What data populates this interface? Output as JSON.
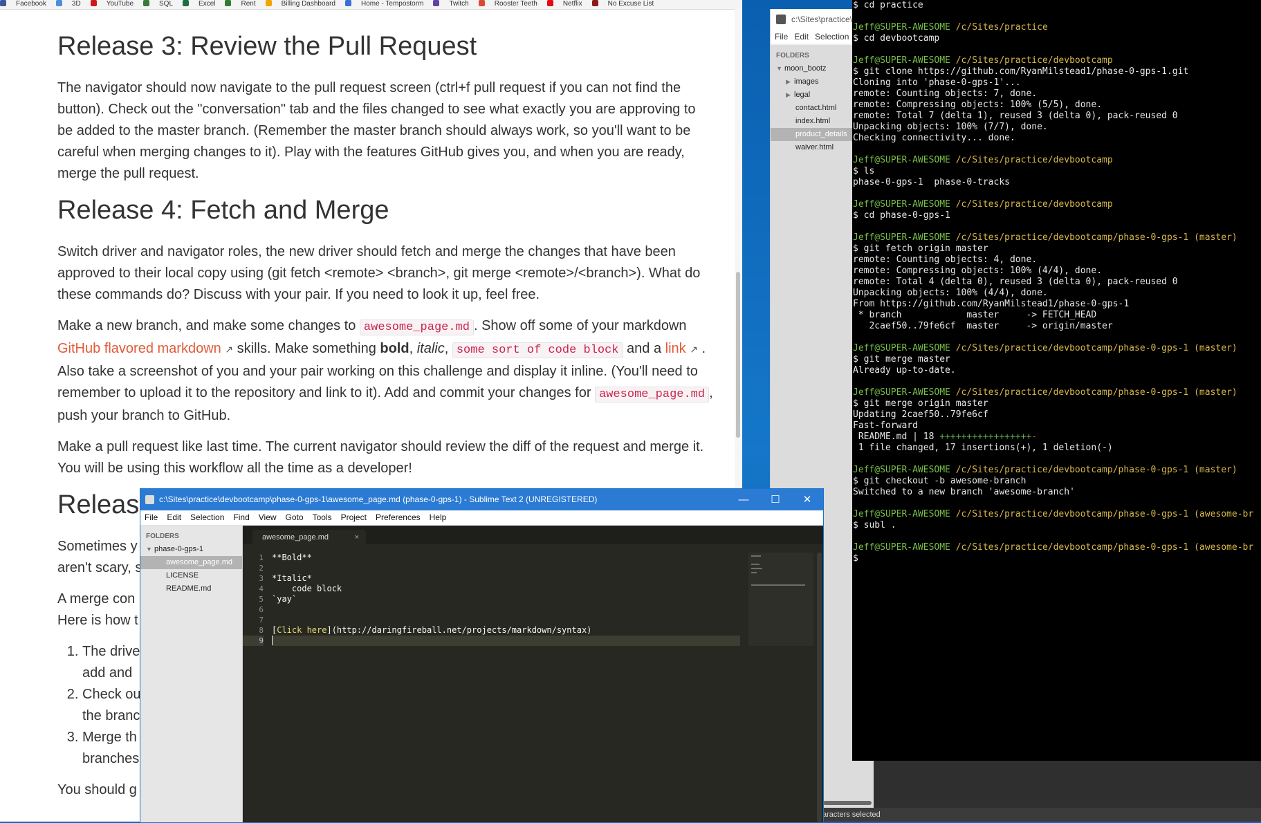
{
  "bookmarks": [
    "Facebook",
    "3D",
    "YouTube",
    "SQL",
    "Excel",
    "Rent",
    "Billing Dashboard",
    "Home - Tempostorm",
    "Twitch",
    "Rooster Teeth",
    "Netflix",
    "No Excuse List"
  ],
  "colors": {
    "link": "#e05a39",
    "code_text": "#c7254e",
    "titlebar": "#2b7bd4",
    "prompt": "#79bf46",
    "path": "#d7b84a",
    "editor_bg": "#272822"
  },
  "article": {
    "h3": "Release 3: Review the Pull Request",
    "p3": "The navigator should now navigate to the pull request screen (ctrl+f pull request if you can not find the button). Check out the \"conversation\" tab and the files changed to see what exactly you are approving to be added to the master branch. (Remember the master branch should always work, so you'll want to be careful when merging changes to it). Play with the features GitHub gives you, and when you are ready, merge the pull request.",
    "h4": "Release 4: Fetch and Merge",
    "p4a": "Switch driver and navigator roles, the new driver should fetch and merge the changes that have been approved to their local copy using (git fetch <remote> <branch>, git merge <remote>/<branch>). What do these commands do? Discuss with your pair. If you need to look it up, feel free.",
    "p4b": {
      "t1": "Make a new branch, and make some changes to ",
      "c1": "awesome_page.md",
      "t2": ". Show off some of your markdown ",
      "link1": "GitHub flavored markdown",
      "t3": " skills. Make something ",
      "bold": "bold",
      "t4": ", ",
      "italic": "italic",
      "t5": ", ",
      "c2": "some sort of code block",
      "t6": " and a ",
      "link2": "link",
      "t7": " . Also take a screenshot of you and your pair working on this challenge and display it inline. (You'll need to remember to upload it to the repository and link to it). Add and commit your changes for ",
      "c3": "awesome_page.md",
      "t8": ", push your branch to GitHub."
    },
    "p4c": "Make a pull request like last time. The current navigator should review the diff of the request and merge it. You will be using this workflow all the time as a developer!",
    "h5": "Release",
    "p5a": "Sometimes y",
    "p5b": "aren't scary, s",
    "p5c": "A merge con",
    "p5d": "Here is how t",
    "list": [
      "The drive",
      "add and",
      "Check ou",
      "the branc",
      "Merge th",
      "branches"
    ],
    "p5e": "You should g"
  },
  "sublime_back": {
    "title": "c:\\Sites\\practice\\",
    "menu": [
      "File",
      "Edit",
      "Selection"
    ],
    "folders_label": "FOLDERS",
    "root": "moon_bootz",
    "items": [
      "images",
      "legal",
      "contact.html",
      "index.html",
      "product_details",
      "waiver.html"
    ],
    "status": "aracters selected"
  },
  "terminal": {
    "lines": [
      [
        "cmd",
        "$ cd practice"
      ],
      [
        "blank",
        ""
      ],
      [
        "prompt",
        "Jeff@SUPER-AWESOME",
        " /c/Sites/practice"
      ],
      [
        "cmd",
        "$ cd devbootcamp"
      ],
      [
        "blank",
        ""
      ],
      [
        "prompt",
        "Jeff@SUPER-AWESOME",
        " /c/Sites/practice/devbootcamp"
      ],
      [
        "cmd",
        "$ git clone https://github.com/RyanMilstead1/phase-0-gps-1.git"
      ],
      [
        "out",
        "Cloning into 'phase-0-gps-1'..."
      ],
      [
        "out",
        "remote: Counting objects: 7, done."
      ],
      [
        "out",
        "remote: Compressing objects: 100% (5/5), done."
      ],
      [
        "out",
        "remote: Total 7 (delta 1), reused 3 (delta 0), pack-reused 0"
      ],
      [
        "out",
        "Unpacking objects: 100% (7/7), done."
      ],
      [
        "out",
        "Checking connectivity... done."
      ],
      [
        "blank",
        ""
      ],
      [
        "prompt",
        "Jeff@SUPER-AWESOME",
        " /c/Sites/practice/devbootcamp"
      ],
      [
        "cmd",
        "$ ls"
      ],
      [
        "out",
        "phase-0-gps-1  phase-0-tracks"
      ],
      [
        "blank",
        ""
      ],
      [
        "prompt",
        "Jeff@SUPER-AWESOME",
        " /c/Sites/practice/devbootcamp"
      ],
      [
        "cmd",
        "$ cd phase-0-gps-1"
      ],
      [
        "blank",
        ""
      ],
      [
        "prompt",
        "Jeff@SUPER-AWESOME",
        " /c/Sites/practice/devbootcamp/phase-0-gps-1 (master)"
      ],
      [
        "cmd",
        "$ git fetch origin master"
      ],
      [
        "out",
        "remote: Counting objects: 4, done."
      ],
      [
        "out",
        "remote: Compressing objects: 100% (4/4), done."
      ],
      [
        "out",
        "remote: Total 4 (delta 0), reused 3 (delta 0), pack-reused 0"
      ],
      [
        "out",
        "Unpacking objects: 100% (4/4), done."
      ],
      [
        "out",
        "From https://github.com/RyanMilstead1/phase-0-gps-1"
      ],
      [
        "out",
        " * branch            master     -> FETCH_HEAD"
      ],
      [
        "out",
        "   2caef50..79fe6cf  master     -> origin/master"
      ],
      [
        "blank",
        ""
      ],
      [
        "prompt",
        "Jeff@SUPER-AWESOME",
        " /c/Sites/practice/devbootcamp/phase-0-gps-1 (master)"
      ],
      [
        "cmd",
        "$ git merge master"
      ],
      [
        "out",
        "Already up-to-date."
      ],
      [
        "blank",
        ""
      ],
      [
        "prompt",
        "Jeff@SUPER-AWESOME",
        " /c/Sites/practice/devbootcamp/phase-0-gps-1 (master)"
      ],
      [
        "cmd",
        "$ git merge origin master"
      ],
      [
        "out",
        "Updating 2caef50..79fe6cf"
      ],
      [
        "out",
        "Fast-forward"
      ],
      [
        "diff",
        " README.md | 18 ",
        "+++++++++++++++++",
        "-"
      ],
      [
        "out",
        " 1 file changed, 17 insertions(+), 1 deletion(-)"
      ],
      [
        "blank",
        ""
      ],
      [
        "prompt",
        "Jeff@SUPER-AWESOME",
        " /c/Sites/practice/devbootcamp/phase-0-gps-1 (master)"
      ],
      [
        "cmd",
        "$ git checkout -b awesome-branch"
      ],
      [
        "out",
        "Switched to a new branch 'awesome-branch'"
      ],
      [
        "blank",
        ""
      ],
      [
        "prompt",
        "Jeff@SUPER-AWESOME",
        " /c/Sites/practice/devbootcamp/phase-0-gps-1 (awesome-br"
      ],
      [
        "cmd",
        "$ subl ."
      ],
      [
        "blank",
        ""
      ],
      [
        "prompt",
        "Jeff@SUPER-AWESOME",
        " /c/Sites/practice/devbootcamp/phase-0-gps-1 (awesome-br"
      ],
      [
        "cmd",
        "$"
      ]
    ]
  },
  "sublime": {
    "title": "c:\\Sites\\practice\\devbootcamp\\phase-0-gps-1\\awesome_page.md (phase-0-gps-1) - Sublime Text 2 (UNREGISTERED)",
    "menu": [
      "File",
      "Edit",
      "Selection",
      "Find",
      "View",
      "Goto",
      "Tools",
      "Project",
      "Preferences",
      "Help"
    ],
    "folders_label": "FOLDERS",
    "root": "phase-0-gps-1",
    "files": [
      "awesome_page.md",
      "LICENSE",
      "README.md"
    ],
    "tab": "awesome_page.md",
    "tab_close": "×",
    "controls": {
      "minimize": "—",
      "maximize": "☐",
      "close": "✕"
    },
    "lines": [
      "**Bold**",
      "",
      "*Italic*",
      "    code block",
      "`yay`",
      "",
      "",
      "[Click here](http://daringfireball.net/projects/markdown/syntax)",
      ""
    ],
    "line_numbers": [
      "1",
      "2",
      "3",
      "4",
      "5",
      "6",
      "7",
      "8",
      "9"
    ]
  }
}
